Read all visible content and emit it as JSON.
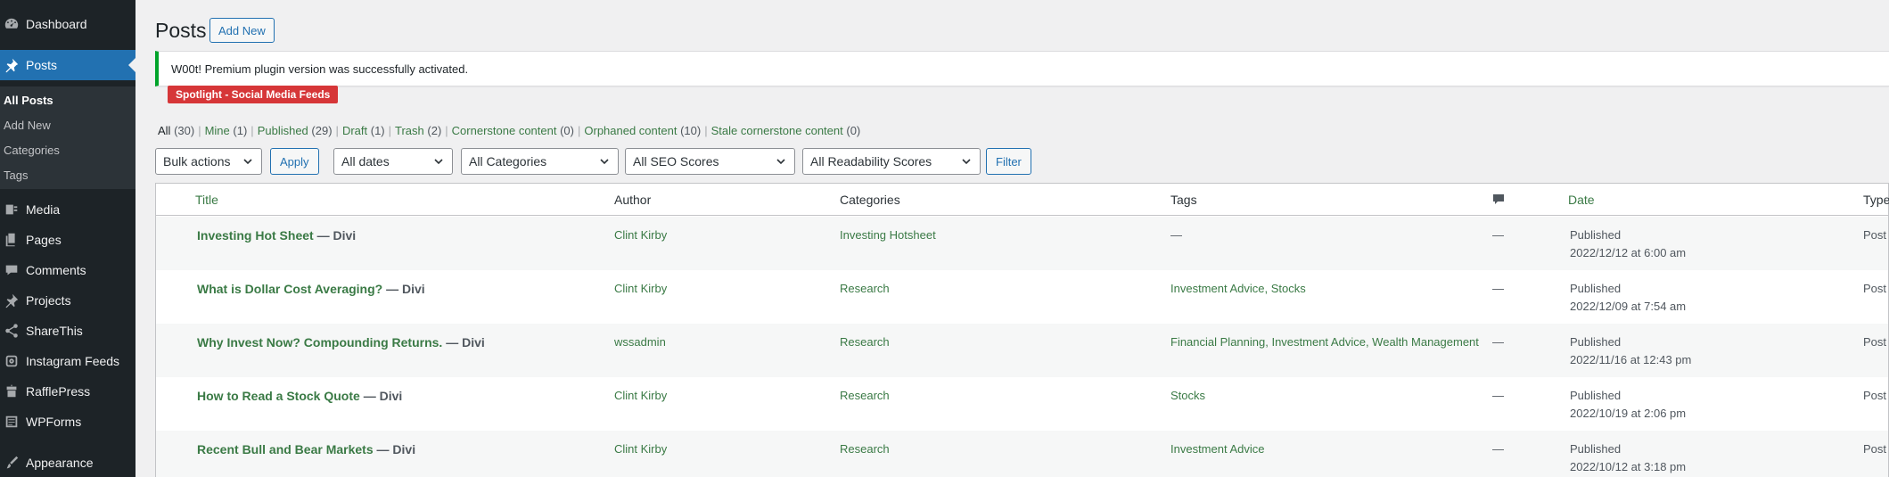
{
  "sidebar": {
    "items": [
      {
        "label": "Dashboard",
        "icon": "dashboard-icon"
      },
      {
        "label": "Posts",
        "icon": "pin-icon"
      },
      {
        "label": "Media",
        "icon": "media-icon"
      },
      {
        "label": "Pages",
        "icon": "pages-icon"
      },
      {
        "label": "Comments",
        "icon": "comment-icon"
      },
      {
        "label": "Projects",
        "icon": "pin-icon"
      },
      {
        "label": "ShareThis",
        "icon": "share-icon"
      },
      {
        "label": "Instagram Feeds",
        "icon": "instagram-icon"
      },
      {
        "label": "RafflePress",
        "icon": "rafflepress-icon"
      },
      {
        "label": "WPForms",
        "icon": "wpforms-icon"
      },
      {
        "label": "Appearance",
        "icon": "brush-icon"
      }
    ],
    "submenu": [
      "All Posts",
      "Add New",
      "Categories",
      "Tags"
    ]
  },
  "header": {
    "title": "Posts",
    "add_new": "Add New"
  },
  "notice": {
    "bold": "W00t!",
    "text": " Premium plugin version was successfully activated."
  },
  "spotlight": "Spotlight - Social Media Feeds",
  "views": [
    {
      "label": "All",
      "count": "(30)"
    },
    {
      "label": "Mine",
      "count": "(1)"
    },
    {
      "label": "Published",
      "count": "(29)"
    },
    {
      "label": "Draft",
      "count": "(1)"
    },
    {
      "label": "Trash",
      "count": "(2)"
    },
    {
      "label": "Cornerstone content",
      "count": "(0)"
    },
    {
      "label": "Orphaned content",
      "count": "(10)"
    },
    {
      "label": "Stale cornerstone content",
      "count": "(0)"
    }
  ],
  "filters": {
    "bulk_actions": "Bulk actions",
    "apply": "Apply",
    "dates": "All dates",
    "categories": "All Categories",
    "seo": "All SEO Scores",
    "readability": "All Readability Scores",
    "filter": "Filter"
  },
  "columns": {
    "title": "Title",
    "author": "Author",
    "categories": "Categories",
    "tags": "Tags",
    "date": "Date",
    "type": "Type"
  },
  "rows": [
    {
      "title": "Investing Hot Sheet",
      "suffix": " — Divi",
      "author": "Clint Kirby",
      "categories": "Investing Hotsheet",
      "tags": "—",
      "comments": "—",
      "status": "Published",
      "date": "2022/12/12 at 6:00 am",
      "type": "Post"
    },
    {
      "title": "What is Dollar Cost Averaging?",
      "suffix": " — Divi",
      "author": "Clint Kirby",
      "categories": "Research",
      "tags": "Investment Advice, Stocks",
      "comments": "—",
      "status": "Published",
      "date": "2022/12/09 at 7:54 am",
      "type": "Post"
    },
    {
      "title": "Why Invest Now? Compounding Returns.",
      "suffix": " — Divi",
      "author": "wssadmin",
      "categories": "Research",
      "tags": "Financial Planning, Investment Advice, Wealth Management",
      "comments": "—",
      "status": "Published",
      "date": "2022/11/16 at 12:43 pm",
      "type": "Post"
    },
    {
      "title": "How to Read a Stock Quote",
      "suffix": " — Divi",
      "author": "Clint Kirby",
      "categories": "Research",
      "tags": "Stocks",
      "comments": "—",
      "status": "Published",
      "date": "2022/10/19 at 2:06 pm",
      "type": "Post"
    },
    {
      "title": "Recent Bull and Bear Markets",
      "suffix": " — Divi",
      "author": "Clint Kirby",
      "categories": "Research",
      "tags": "Investment Advice",
      "comments": "—",
      "status": "Published",
      "date": "2022/10/12 at 3:18 pm",
      "type": "Post"
    }
  ]
}
